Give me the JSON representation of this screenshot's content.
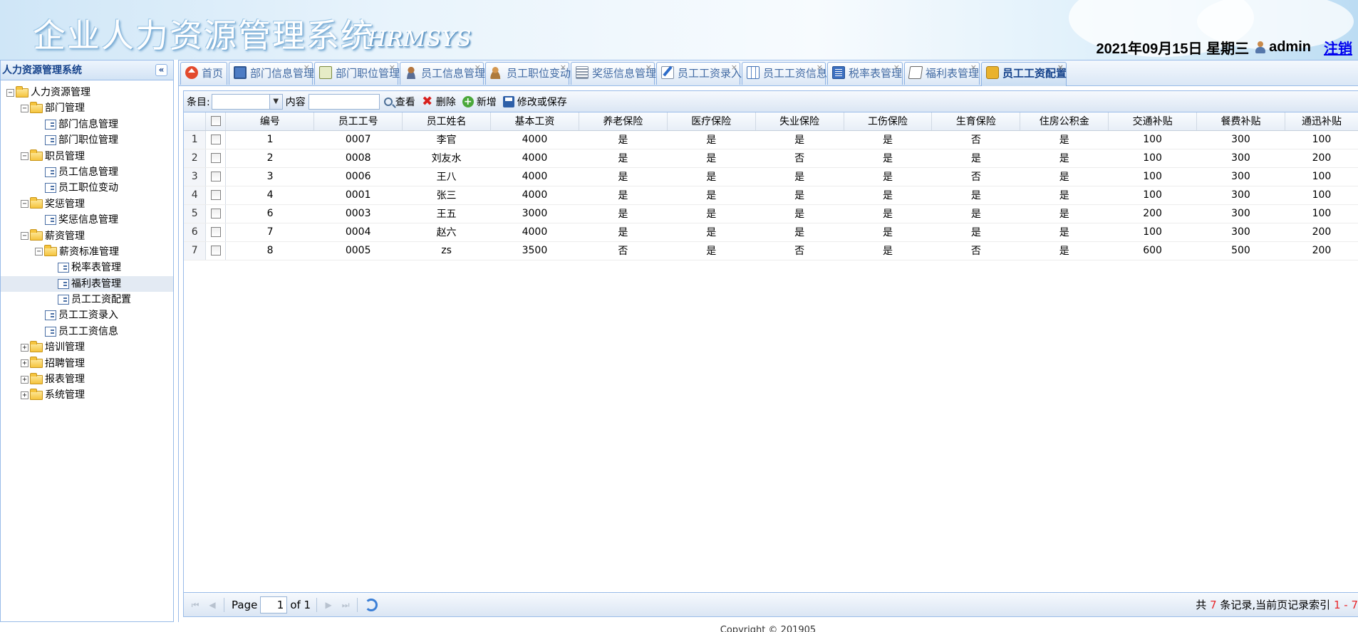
{
  "header": {
    "title": "企业人力资源管理系统",
    "subtitle": "HRMSYS",
    "date": "2021年09月15日 星期三",
    "username": "admin",
    "logout": "注销"
  },
  "sidebar": {
    "title": "人力资源管理系统",
    "tree": [
      {
        "label": "人力资源管理",
        "level": 0,
        "type": "folder",
        "toggle": "−"
      },
      {
        "label": "部门管理",
        "level": 1,
        "type": "folder",
        "toggle": "−"
      },
      {
        "label": "部门信息管理",
        "level": 2,
        "type": "leaf"
      },
      {
        "label": "部门职位管理",
        "level": 2,
        "type": "leaf"
      },
      {
        "label": "职员管理",
        "level": 1,
        "type": "folder",
        "toggle": "−"
      },
      {
        "label": "员工信息管理",
        "level": 2,
        "type": "leaf"
      },
      {
        "label": "员工职位变动",
        "level": 2,
        "type": "leaf"
      },
      {
        "label": "奖惩管理",
        "level": 1,
        "type": "folder",
        "toggle": "−"
      },
      {
        "label": "奖惩信息管理",
        "level": 2,
        "type": "leaf"
      },
      {
        "label": "薪资管理",
        "level": 1,
        "type": "folder",
        "toggle": "−"
      },
      {
        "label": "薪资标准管理",
        "level": 2,
        "type": "folder",
        "toggle": "−"
      },
      {
        "label": "税率表管理",
        "level": 3,
        "type": "leaf"
      },
      {
        "label": "福利表管理",
        "level": 3,
        "type": "leaf",
        "selected": true
      },
      {
        "label": "员工工资配置",
        "level": 3,
        "type": "leaf"
      },
      {
        "label": "员工工资录入",
        "level": 2,
        "type": "leaf"
      },
      {
        "label": "员工工资信息",
        "level": 2,
        "type": "leaf"
      },
      {
        "label": "培训管理",
        "level": 1,
        "type": "folder",
        "toggle": "+"
      },
      {
        "label": "招聘管理",
        "level": 1,
        "type": "folder",
        "toggle": "+"
      },
      {
        "label": "报表管理",
        "level": 1,
        "type": "folder",
        "toggle": "+"
      },
      {
        "label": "系统管理",
        "level": 1,
        "type": "folder",
        "toggle": "+"
      }
    ]
  },
  "tabs": [
    {
      "label": "首页",
      "icon": "home-icon",
      "closable": false
    },
    {
      "label": "部门信息管理",
      "icon": "monitor-icon",
      "closable": true
    },
    {
      "label": "部门职位管理",
      "icon": "card-icon",
      "closable": true
    },
    {
      "label": "员工信息管理",
      "icon": "person-icon",
      "closable": true
    },
    {
      "label": "员工职位变动",
      "icon": "change-icon",
      "closable": true
    },
    {
      "label": "奖惩信息管理",
      "icon": "list-icon",
      "closable": true
    },
    {
      "label": "员工工资录入",
      "icon": "pen-icon",
      "closable": true
    },
    {
      "label": "员工工资信息",
      "icon": "table-icon",
      "closable": true
    },
    {
      "label": "税率表管理",
      "icon": "book-icon",
      "closable": true
    },
    {
      "label": "福利表管理",
      "icon": "doc-icon",
      "closable": true
    },
    {
      "label": "员工工资配置",
      "icon": "wallet-icon",
      "closable": true,
      "active": true
    }
  ],
  "toolbar": {
    "field_label": "条目:",
    "field_value": "",
    "content_label": "内容",
    "content_value": "",
    "view": "查看",
    "delete": "删除",
    "add": "新增",
    "save": "修改或保存"
  },
  "grid": {
    "columns": [
      "编号",
      "员工工号",
      "员工姓名",
      "基本工资",
      "养老保险",
      "医疗保险",
      "失业保险",
      "工伤保险",
      "生育保险",
      "住房公积金",
      "交通补贴",
      "餐费补贴",
      "通迅补贴"
    ],
    "rows": [
      [
        "1",
        "0007",
        "李官",
        "4000",
        "是",
        "是",
        "是",
        "是",
        "否",
        "是",
        "100",
        "300",
        "100"
      ],
      [
        "2",
        "0008",
        "刘友水",
        "4000",
        "是",
        "是",
        "否",
        "是",
        "是",
        "是",
        "100",
        "300",
        "200"
      ],
      [
        "3",
        "0006",
        "王八",
        "4000",
        "是",
        "是",
        "是",
        "是",
        "否",
        "是",
        "100",
        "300",
        "100"
      ],
      [
        "4",
        "0001",
        "张三",
        "4000",
        "是",
        "是",
        "是",
        "是",
        "是",
        "是",
        "100",
        "300",
        "100"
      ],
      [
        "6",
        "0003",
        "王五",
        "3000",
        "是",
        "是",
        "是",
        "是",
        "是",
        "是",
        "200",
        "300",
        "100"
      ],
      [
        "7",
        "0004",
        "赵六",
        "4000",
        "是",
        "是",
        "是",
        "是",
        "是",
        "是",
        "100",
        "300",
        "200"
      ],
      [
        "8",
        "0005",
        "zs",
        "3500",
        "否",
        "是",
        "否",
        "是",
        "否",
        "是",
        "600",
        "500",
        "200"
      ]
    ]
  },
  "pager": {
    "page_label": "Page",
    "page_value": "1",
    "of_label": "of 1",
    "info_prefix": "共",
    "total": "7",
    "info_mid": "条记录,当前页记录索引",
    "range": "1 - 7"
  },
  "footer": {
    "copyright": "Copyright © 201905"
  }
}
